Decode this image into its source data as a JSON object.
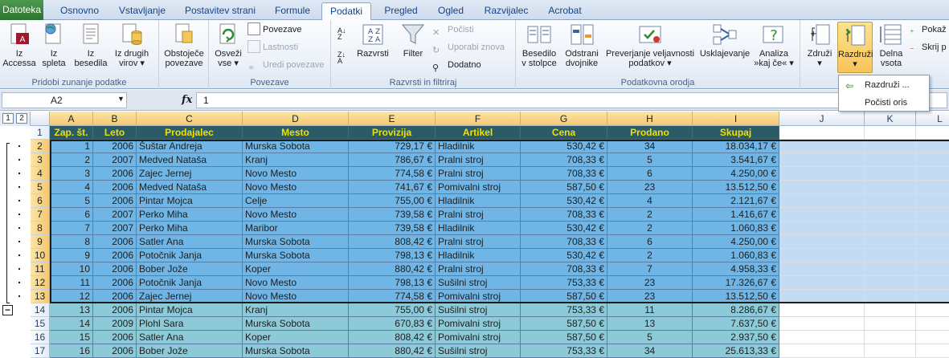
{
  "tabs": [
    "Datoteka",
    "Osnovno",
    "Vstavljanje",
    "Postavitev strani",
    "Formule",
    "Podatki",
    "Pregled",
    "Ogled",
    "Razvijalec",
    "Acrobat"
  ],
  "active_tab": "Podatki",
  "ribbon": {
    "group_external": {
      "label": "Pridobi zunanje podatke",
      "btn_access": "Iz\nAccessa",
      "btn_web": "Iz\nspleta",
      "btn_text": "Iz\nbesedila",
      "btn_other": "Iz drugih\nvirov ▾",
      "btn_existing": "Obstoječe\npovezave"
    },
    "group_connections": {
      "label": "Povezave",
      "btn_refresh": "Osveži\nvse ▾",
      "connections": "Povezave",
      "properties": "Lastnosti",
      "edit_links": "Uredi povezave"
    },
    "group_sort": {
      "label": "Razvrsti in filtriraj",
      "sort": "Razvrsti",
      "filter": "Filter",
      "clear": "Počisti",
      "reapply": "Uporabi znova",
      "advanced": "Dodatno"
    },
    "group_tools": {
      "label": "Podatkovna orodja",
      "text_to_cols": "Besedilo\nv stolpce",
      "remove_dupes": "Odstrani\ndvojnike",
      "validation": "Preverjanje veljavnosti\npodatkov ▾",
      "consolidate": "Usklajevanje",
      "whatif": "Analiza\n»kaj če« ▾"
    },
    "group_outline": {
      "group": "Združi\n▾",
      "ungroup": "Razdruži\n▾",
      "subtotal": "Delna\nvsota",
      "show_detail": "Pokaž",
      "hide_detail": "Skrij p"
    }
  },
  "dropdown": {
    "ungroup_item": "Razdruži ...",
    "clear_outline": "Počisti oris"
  },
  "formula_bar": {
    "name_box": "A2",
    "fx": "fx",
    "value": "1"
  },
  "outline_levels": [
    "1",
    "2"
  ],
  "columns": [
    "A",
    "B",
    "C",
    "D",
    "E",
    "F",
    "G",
    "H",
    "I",
    "J",
    "K",
    "L"
  ],
  "header_row": [
    "Zap. št.",
    "Leto",
    "Prodajalec",
    "Mesto",
    "Provizija",
    "Artikel",
    "Cena",
    "Prodano",
    "Skupaj"
  ],
  "rows": [
    {
      "n": "2",
      "cells": [
        "1",
        "2006",
        "Šuštar Andreja",
        "Murska Sobota",
        "729,17 €",
        "Hladilnik",
        "530,42 €",
        "34",
        "18.034,17 €"
      ]
    },
    {
      "n": "3",
      "cells": [
        "2",
        "2007",
        "Medved Nataša",
        "Kranj",
        "786,67 €",
        "Pralni stroj",
        "708,33 €",
        "5",
        "3.541,67 €"
      ]
    },
    {
      "n": "4",
      "cells": [
        "3",
        "2006",
        "Zajec Jernej",
        "Novo Mesto",
        "774,58 €",
        "Pralni stroj",
        "708,33 €",
        "6",
        "4.250,00 €"
      ]
    },
    {
      "n": "5",
      "cells": [
        "4",
        "2006",
        "Medved Nataša",
        "Novo Mesto",
        "741,67 €",
        "Pomivalni stroj",
        "587,50 €",
        "23",
        "13.512,50 €"
      ]
    },
    {
      "n": "6",
      "cells": [
        "5",
        "2006",
        "Pintar Mojca",
        "Celje",
        "755,00 €",
        "Hladilnik",
        "530,42 €",
        "4",
        "2.121,67 €"
      ]
    },
    {
      "n": "7",
      "cells": [
        "6",
        "2007",
        "Perko Miha",
        "Novo Mesto",
        "739,58 €",
        "Pralni stroj",
        "708,33 €",
        "2",
        "1.416,67 €"
      ]
    },
    {
      "n": "8",
      "cells": [
        "7",
        "2007",
        "Perko Miha",
        "Maribor",
        "739,58 €",
        "Hladilnik",
        "530,42 €",
        "2",
        "1.060,83 €"
      ]
    },
    {
      "n": "9",
      "cells": [
        "8",
        "2006",
        "Satler Ana",
        "Murska Sobota",
        "808,42 €",
        "Pralni stroj",
        "708,33 €",
        "6",
        "4.250,00 €"
      ]
    },
    {
      "n": "10",
      "cells": [
        "9",
        "2006",
        "Potočnik Janja",
        "Murska Sobota",
        "798,13 €",
        "Hladilnik",
        "530,42 €",
        "2",
        "1.060,83 €"
      ]
    },
    {
      "n": "11",
      "cells": [
        "10",
        "2006",
        "Bober Jože",
        "Koper",
        "880,42 €",
        "Pralni stroj",
        "708,33 €",
        "7",
        "4.958,33 €"
      ]
    },
    {
      "n": "12",
      "cells": [
        "11",
        "2006",
        "Potočnik Janja",
        "Novo Mesto",
        "798,13 €",
        "Sušilni stroj",
        "753,33 €",
        "23",
        "17.326,67 €"
      ]
    },
    {
      "n": "13",
      "cells": [
        "12",
        "2006",
        "Zajec Jernej",
        "Novo Mesto",
        "774,58 €",
        "Pomivalni stroj",
        "587,50 €",
        "23",
        "13.512,50 €"
      ]
    },
    {
      "n": "14",
      "cells": [
        "13",
        "2006",
        "Pintar Mojca",
        "Kranj",
        "755,00 €",
        "Sušilni stroj",
        "753,33 €",
        "11",
        "8.286,67 €"
      ]
    },
    {
      "n": "15",
      "cells": [
        "14",
        "2009",
        "Plohl Sara",
        "Murska Sobota",
        "670,83 €",
        "Pomivalni stroj",
        "587,50 €",
        "13",
        "7.637,50 €"
      ]
    },
    {
      "n": "16",
      "cells": [
        "15",
        "2006",
        "Satler Ana",
        "Koper",
        "808,42 €",
        "Pomivalni stroj",
        "587,50 €",
        "5",
        "2.937,50 €"
      ]
    },
    {
      "n": "17",
      "cells": [
        "16",
        "2006",
        "Bober Jože",
        "Murska Sobota",
        "880,42 €",
        "Sušilni stroj",
        "753,33 €",
        "34",
        "25.613,33 €"
      ]
    }
  ],
  "colors": {
    "header_bg": "#2a5b66",
    "header_text": "#f0e000",
    "selected_row_bg": "#6fb6e6",
    "normal_row_bg": "#8ccad8",
    "selected_empty_bg": "#c3dcf3",
    "file_tab": "#2b742f"
  }
}
